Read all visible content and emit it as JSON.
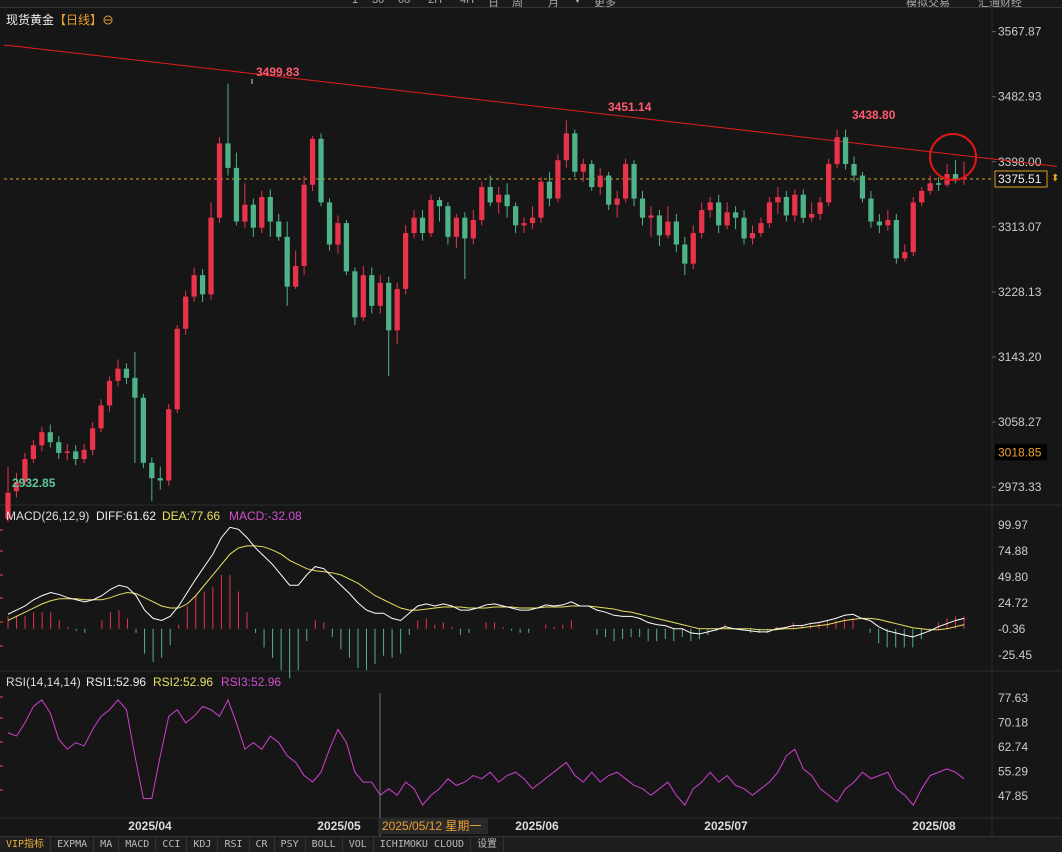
{
  "instrument": {
    "name": "现货黄金",
    "period": "【日线】",
    "settings_icon": "gear-circle-icon"
  },
  "toolbar_partial": [
    "1",
    "30",
    "60",
    "2H",
    "4H",
    "日",
    "周",
    "月",
    "▼",
    "更多",
    "模拟交易",
    "汇通财经"
  ],
  "main_axis": {
    "ticks": [
      "3567.87",
      "3482.93",
      "3398.00",
      "3313.07",
      "3228.13",
      "3143.20",
      "3058.27",
      "2973.33"
    ],
    "min": 2950,
    "max": 3570
  },
  "price_badges": {
    "current": "3375.51",
    "crosshair": "3018.85"
  },
  "annotations": {
    "high1": "3499.83",
    "high2": "3451.14",
    "high3": "3438.80",
    "low": "2932.85"
  },
  "macd_header": {
    "name": "MACD(26,12,9)",
    "diff": "DIFF:61.62",
    "dea": "DEA:77.66",
    "macd": "MACD:-32.08"
  },
  "macd_axis": [
    "99.97",
    "74.88",
    "49.80",
    "24.72",
    "-0.36",
    "-25.45"
  ],
  "rsi_header": {
    "name": "RSI(14,14,14)",
    "rsi1": "RSI1:52.96",
    "rsi2": "RSI2:52.96",
    "rsi3": "RSI3:52.96"
  },
  "rsi_axis": [
    "77.63",
    "70.18",
    "62.74",
    "55.29",
    "47.85"
  ],
  "date_axis": [
    "2025/04",
    "2025/05",
    "2025/06",
    "2025/07",
    "2025/08"
  ],
  "crosshair_date": "2025/05/12 星期一",
  "bottom_tabs": [
    "VIP指标",
    "EXPMA",
    "MA",
    "MACD",
    "CCI",
    "KDJ",
    "RSI",
    "CR",
    "PSY",
    "BOLL",
    "VOL",
    "ICHIMOKU CLOUD",
    "设置"
  ],
  "colors": {
    "up": "#e8334a",
    "down": "#4fb38a",
    "diff": "#ffffff",
    "dea": "#e8e060",
    "macd": "#d050d0",
    "trend": "#e02020",
    "last": "#f0a030"
  },
  "chart_data": {
    "type": "candlestick",
    "bars": [
      [
        2932,
        2966,
        3000,
        2928
      ],
      [
        2968,
        2980,
        2992,
        2960
      ],
      [
        2980,
        3010,
        3018,
        2975
      ],
      [
        3010,
        3028,
        3035,
        3005
      ],
      [
        3028,
        3045,
        3052,
        3020
      ],
      [
        3045,
        3032,
        3055,
        3025
      ],
      [
        3032,
        3018,
        3040,
        3010
      ],
      [
        3018,
        3020,
        3030,
        3008
      ],
      [
        3020,
        3010,
        3028,
        3002
      ],
      [
        3010,
        3022,
        3030,
        3005
      ],
      [
        3022,
        3050,
        3058,
        3015
      ],
      [
        3050,
        3080,
        3088,
        3045
      ],
      [
        3080,
        3112,
        3118,
        3072
      ],
      [
        3112,
        3128,
        3140,
        3105
      ],
      [
        3128,
        3116,
        3135,
        3108
      ],
      [
        3116,
        3090,
        3150,
        3005
      ],
      [
        3090,
        3005,
        3095,
        2998
      ],
      [
        3005,
        2985,
        3012,
        2955
      ],
      [
        2985,
        2982,
        3000,
        2970
      ],
      [
        2982,
        3075,
        3082,
        2975
      ],
      [
        3075,
        3180,
        3185,
        3070
      ],
      [
        3180,
        3222,
        3230,
        3172
      ],
      [
        3222,
        3250,
        3260,
        3215
      ],
      [
        3250,
        3225,
        3258,
        3215
      ],
      [
        3225,
        3325,
        3345,
        3218
      ],
      [
        3325,
        3422,
        3430,
        3318
      ],
      [
        3422,
        3390,
        3500,
        3380
      ],
      [
        3390,
        3320,
        3410,
        3315
      ],
      [
        3320,
        3342,
        3370,
        3312
      ],
      [
        3342,
        3312,
        3350,
        3300
      ],
      [
        3312,
        3352,
        3360,
        3305
      ],
      [
        3352,
        3320,
        3362,
        3300
      ],
      [
        3320,
        3300,
        3330,
        3295
      ],
      [
        3300,
        3235,
        3320,
        3210
      ],
      [
        3235,
        3262,
        3282,
        3232
      ],
      [
        3262,
        3368,
        3380,
        3250
      ],
      [
        3368,
        3428,
        3432,
        3360
      ],
      [
        3428,
        3345,
        3435,
        3340
      ],
      [
        3345,
        3290,
        3350,
        3282
      ],
      [
        3290,
        3318,
        3328,
        3278
      ],
      [
        3318,
        3255,
        3322,
        3250
      ],
      [
        3255,
        3195,
        3260,
        3185
      ],
      [
        3195,
        3250,
        3262,
        3190
      ],
      [
        3250,
        3210,
        3260,
        3200
      ],
      [
        3210,
        3240,
        3250,
        3200
      ],
      [
        3240,
        3178,
        3248,
        3118
      ],
      [
        3178,
        3232,
        3240,
        3160
      ],
      [
        3232,
        3305,
        3315,
        3225
      ],
      [
        3305,
        3325,
        3335,
        3298
      ],
      [
        3325,
        3305,
        3335,
        3295
      ],
      [
        3305,
        3348,
        3355,
        3300
      ],
      [
        3348,
        3340,
        3352,
        3320
      ],
      [
        3340,
        3300,
        3345,
        3290
      ],
      [
        3300,
        3325,
        3330,
        3285
      ],
      [
        3325,
        3298,
        3332,
        3245
      ],
      [
        3298,
        3322,
        3335,
        3290
      ],
      [
        3322,
        3365,
        3372,
        3315
      ],
      [
        3365,
        3345,
        3380,
        3340
      ],
      [
        3345,
        3355,
        3365,
        3330
      ],
      [
        3355,
        3340,
        3370,
        3325
      ],
      [
        3340,
        3315,
        3345,
        3305
      ],
      [
        3315,
        3318,
        3325,
        3305
      ],
      [
        3318,
        3325,
        3340,
        3310
      ],
      [
        3325,
        3372,
        3378,
        3318
      ],
      [
        3372,
        3350,
        3385,
        3340
      ],
      [
        3350,
        3400,
        3408,
        3345
      ],
      [
        3400,
        3435,
        3452,
        3390
      ],
      [
        3435,
        3385,
        3440,
        3378
      ],
      [
        3385,
        3395,
        3402,
        3372
      ],
      [
        3395,
        3365,
        3400,
        3360
      ],
      [
        3365,
        3380,
        3390,
        3355
      ],
      [
        3380,
        3342,
        3385,
        3335
      ],
      [
        3342,
        3350,
        3360,
        3325
      ],
      [
        3350,
        3395,
        3402,
        3345
      ],
      [
        3395,
        3350,
        3400,
        3340
      ],
      [
        3350,
        3325,
        3360,
        3315
      ],
      [
        3325,
        3328,
        3340,
        3300
      ],
      [
        3328,
        3302,
        3335,
        3288
      ],
      [
        3302,
        3320,
        3340,
        3298
      ],
      [
        3320,
        3290,
        3330,
        3280
      ],
      [
        3290,
        3265,
        3300,
        3250
      ],
      [
        3265,
        3305,
        3315,
        3258
      ],
      [
        3305,
        3335,
        3345,
        3298
      ],
      [
        3335,
        3345,
        3352,
        3325
      ],
      [
        3345,
        3315,
        3355,
        3305
      ],
      [
        3315,
        3332,
        3345,
        3310
      ],
      [
        3332,
        3325,
        3340,
        3310
      ],
      [
        3325,
        3298,
        3335,
        3290
      ],
      [
        3298,
        3305,
        3315,
        3290
      ],
      [
        3305,
        3318,
        3325,
        3300
      ],
      [
        3318,
        3345,
        3352,
        3312
      ],
      [
        3345,
        3352,
        3365,
        3330
      ],
      [
        3352,
        3328,
        3360,
        3320
      ],
      [
        3328,
        3355,
        3362,
        3320
      ],
      [
        3355,
        3325,
        3362,
        3318
      ],
      [
        3325,
        3330,
        3345,
        3320
      ],
      [
        3330,
        3345,
        3352,
        3322
      ],
      [
        3345,
        3395,
        3402,
        3340
      ],
      [
        3395,
        3430,
        3440,
        3390
      ],
      [
        3430,
        3395,
        3440,
        3388
      ],
      [
        3395,
        3380,
        3405,
        3372
      ],
      [
        3380,
        3350,
        3385,
        3345
      ],
      [
        3350,
        3320,
        3360,
        3312
      ],
      [
        3320,
        3315,
        3330,
        3305
      ],
      [
        3315,
        3322,
        3335,
        3308
      ],
      [
        3322,
        3272,
        3330,
        3265
      ],
      [
        3272,
        3280,
        3290,
        3268
      ],
      [
        3280,
        3345,
        3352,
        3275
      ],
      [
        3345,
        3360,
        3365,
        3340
      ],
      [
        3360,
        3370,
        3380,
        3355
      ],
      [
        3370,
        3368,
        3378,
        3360
      ],
      [
        3368,
        3382,
        3395,
        3365
      ],
      [
        3382,
        3375,
        3400,
        3370
      ],
      [
        3375,
        3378,
        3398,
        3368
      ]
    ],
    "trend_line": {
      "from": {
        "bar": 0,
        "price": 3550
      },
      "to": {
        "bar": 124,
        "price": 3392
      }
    },
    "macd": {
      "diff": [
        14,
        18,
        22,
        28,
        32,
        35,
        33,
        30,
        28,
        26,
        28,
        32,
        38,
        42,
        40,
        32,
        18,
        10,
        8,
        12,
        22,
        35,
        48,
        60,
        72,
        88,
        98,
        96,
        88,
        78,
        70,
        62,
        52,
        42,
        42,
        52,
        60,
        58,
        50,
        42,
        34,
        25,
        18,
        15,
        15,
        10,
        8,
        15,
        22,
        24,
        22,
        24,
        22,
        18,
        18,
        20,
        23,
        24,
        22,
        20,
        18,
        18,
        20,
        23,
        22,
        23,
        26,
        22,
        22,
        18,
        16,
        13,
        12,
        12,
        10,
        6,
        4,
        3,
        0,
        0,
        -4,
        -5,
        -3,
        -1,
        2,
        0,
        -1,
        -2,
        -3,
        -3,
        0,
        1,
        3,
        3,
        5,
        6,
        8,
        10,
        13,
        14,
        10,
        8,
        2,
        -2,
        -4,
        -6,
        -8,
        -5,
        -2,
        2,
        5,
        8,
        10
      ],
      "dea": [
        8,
        12,
        16,
        20,
        24,
        27,
        29,
        29,
        29,
        28,
        28,
        28,
        30,
        33,
        35,
        34,
        30,
        26,
        22,
        20,
        20,
        24,
        32,
        42,
        52,
        62,
        72,
        78,
        80,
        80,
        79,
        76,
        72,
        66,
        62,
        58,
        56,
        55,
        54,
        52,
        48,
        44,
        38,
        32,
        28,
        24,
        20,
        18,
        18,
        19,
        20,
        21,
        21,
        21,
        20,
        20,
        20,
        21,
        21,
        21,
        20,
        20,
        20,
        21,
        21,
        21,
        22,
        22,
        22,
        21,
        20,
        19,
        17,
        16,
        14,
        12,
        10,
        8,
        6,
        4,
        2,
        0,
        0,
        0,
        0,
        0,
        0,
        0,
        -1,
        -1,
        -1,
        0,
        0,
        1,
        2,
        3,
        4,
        6,
        8,
        9,
        10,
        10,
        9,
        7,
        5,
        3,
        1,
        0,
        -1,
        -1,
        0,
        2,
        4
      ]
    },
    "rsi": [
      67,
      66,
      70,
      75,
      77,
      73,
      65,
      62,
      64,
      63,
      68,
      72,
      74,
      77,
      74,
      60,
      47,
      47,
      60,
      72,
      74,
      70,
      72,
      75,
      74,
      72,
      77,
      70,
      62,
      64,
      62,
      66,
      64,
      60,
      58,
      54,
      52,
      55,
      62,
      68,
      64,
      55,
      52,
      52,
      48,
      50,
      48,
      52,
      50,
      45,
      48,
      50,
      53,
      51,
      52,
      54,
      53,
      55,
      52,
      54,
      55,
      53,
      50,
      52,
      54,
      56,
      58,
      54,
      52,
      55,
      52,
      54,
      55,
      53,
      51,
      50,
      48,
      50,
      52,
      48,
      45,
      50,
      52,
      55,
      52,
      54,
      51,
      50,
      48,
      50,
      52,
      55,
      60,
      62,
      56,
      54,
      50,
      48,
      46,
      50,
      52,
      55,
      53,
      54,
      55,
      50,
      48,
      45,
      50,
      54,
      55,
      56,
      55,
      53
    ],
    "x_range": {
      "start": "2025/03",
      "end": "2025/08"
    }
  }
}
